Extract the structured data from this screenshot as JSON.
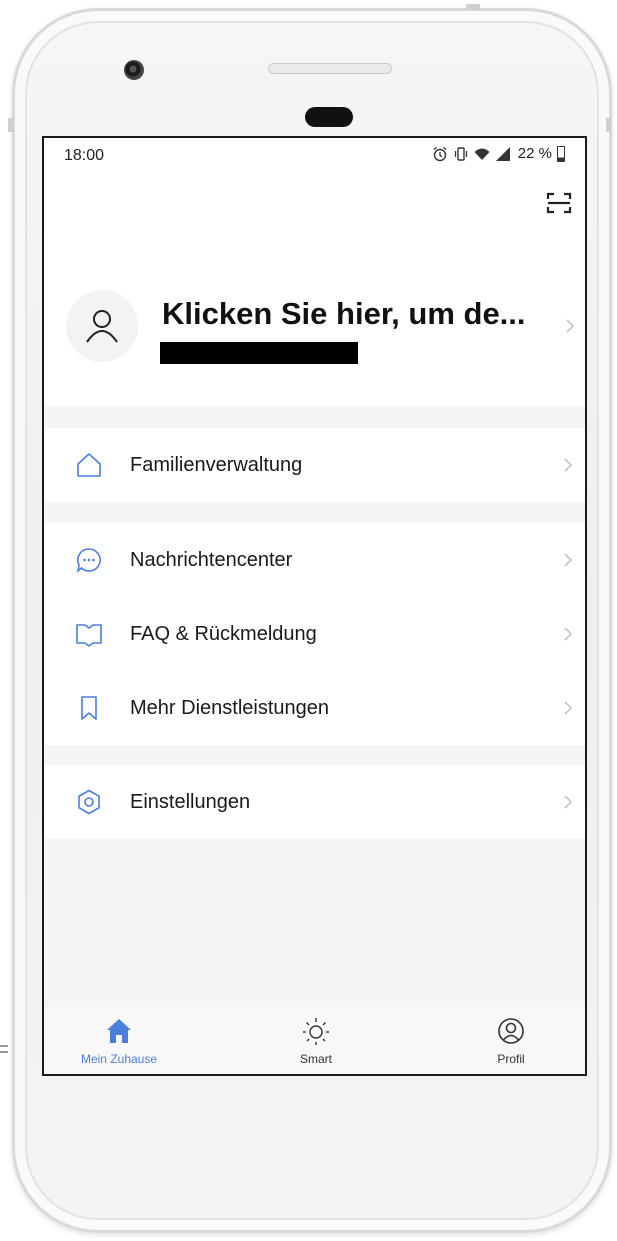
{
  "status": {
    "time": "18:00",
    "battery": "22 %"
  },
  "profile": {
    "name": "Klicken Sie hier, um de..."
  },
  "menu": {
    "groups": [
      [
        {
          "label": "Familienverwaltung",
          "icon": "home-outline-icon"
        }
      ],
      [
        {
          "label": "Nachrichtencenter",
          "icon": "chat-bubble-icon"
        },
        {
          "label": "FAQ & Rückmeldung",
          "icon": "book-icon"
        },
        {
          "label": "Mehr Dienstleistungen",
          "icon": "bookmark-icon"
        }
      ],
      [
        {
          "label": "Einstellungen",
          "icon": "hexagon-settings-icon"
        }
      ]
    ]
  },
  "tabs": [
    {
      "label": "Mein Zuhause",
      "icon": "home-icon",
      "active": true
    },
    {
      "label": "Smart",
      "icon": "sun-icon",
      "active": false
    },
    {
      "label": "Profil",
      "icon": "profile-icon",
      "active": false
    }
  ],
  "colors": {
    "accent": "#4b7fde",
    "text": "#1a1a1a",
    "background": "#f5f5f5"
  }
}
